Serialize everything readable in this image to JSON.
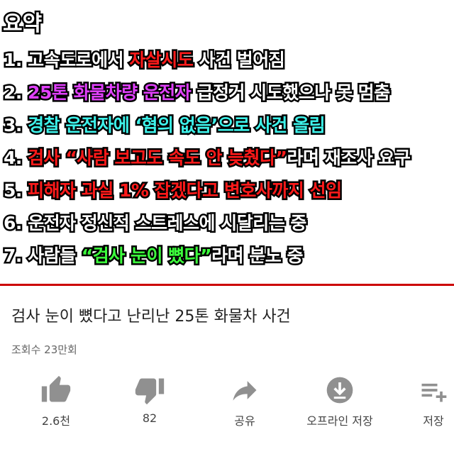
{
  "thumbnail": {
    "heading": "요약",
    "lines": [
      {
        "segments": [
          {
            "text": "1. 고속도로에서 ",
            "color": "white"
          },
          {
            "text": "자살시도",
            "color": "red"
          },
          {
            "text": " 사건 벌어짐",
            "color": "white"
          }
        ]
      },
      {
        "segments": [
          {
            "text": "2. ",
            "color": "white"
          },
          {
            "text": "25톤 화물차량 운전자",
            "color": "pink"
          },
          {
            "text": " 급정거 시도했으나 못 멈춤",
            "color": "white"
          }
        ]
      },
      {
        "segments": [
          {
            "text": "3. ",
            "color": "white"
          },
          {
            "text": "경찰 운전자에 ‘혐의 없음’으로 사건 올림",
            "color": "cyan"
          }
        ]
      },
      {
        "segments": [
          {
            "text": "4. ",
            "color": "white"
          },
          {
            "text": "검사 “사람 보고도 속도 안 늦췄다”",
            "color": "red"
          },
          {
            "text": "라며 재조사 요구",
            "color": "white"
          }
        ]
      },
      {
        "segments": [
          {
            "text": "5. ",
            "color": "white"
          },
          {
            "text": "피해자 과실 1% 잡겠다고 변호사까지 선임",
            "color": "red"
          }
        ]
      },
      {
        "segments": [
          {
            "text": "6. 운전자 정신적 스트레스에 시달리는 중",
            "color": "white"
          }
        ]
      },
      {
        "segments": [
          {
            "text": "7. 사람들 ",
            "color": "white"
          },
          {
            "text": "“검사 눈이 뼜다”",
            "color": "green"
          },
          {
            "text": "라며 분노 중",
            "color": "white"
          }
        ]
      }
    ]
  },
  "video": {
    "title": "검사 눈이 뼜다고 난리난 25톤 화물차 사건",
    "views": "조회수 23만회"
  },
  "actions": [
    {
      "name": "like",
      "icon": "thumbs-up-icon",
      "label": "2.6천"
    },
    {
      "name": "dislike",
      "icon": "thumbs-down-icon",
      "label": "82"
    },
    {
      "name": "share",
      "icon": "share-icon",
      "label": "공유"
    },
    {
      "name": "download",
      "icon": "download-icon",
      "label": "오프라인 저장"
    },
    {
      "name": "save",
      "icon": "playlist-add-icon",
      "label": "저장"
    }
  ],
  "colors": {
    "white": "#ffffff",
    "red": "#ff1a1a",
    "pink": "#e040fb",
    "cyan": "#3df2ea",
    "green": "#3cff3c",
    "icon_gray": "#909090",
    "accent_red": "#cc0000"
  }
}
